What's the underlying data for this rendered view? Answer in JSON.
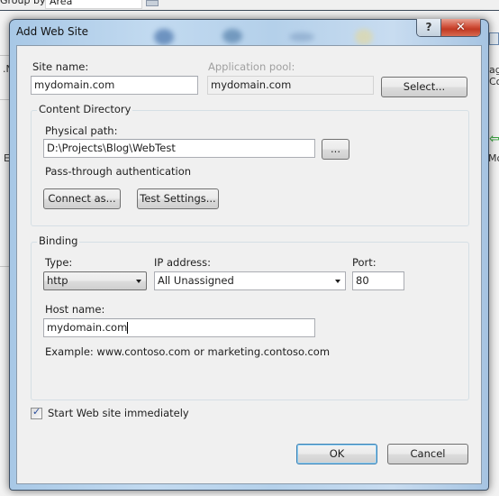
{
  "background": {
    "group_by_label": "Group by:",
    "group_by_value": "Area",
    "left_snippets": [
      ".N",
      "E"
    ],
    "right_snippets": [
      "age",
      "Cor",
      "Mo"
    ]
  },
  "dialog": {
    "title": "Add Web Site",
    "help_glyph": "?",
    "close_glyph": "✕",
    "site_name": {
      "label": "Site name:",
      "value": "mydomain.com"
    },
    "application_pool": {
      "label": "Application pool:",
      "value": "mydomain.com",
      "select_button": "Select..."
    },
    "content_directory": {
      "legend": "Content Directory",
      "physical_path_label": "Physical path:",
      "physical_path_value": "D:\\Projects\\Blog\\WebTest",
      "browse_button": "...",
      "auth_label": "Pass-through authentication",
      "connect_as_button": "Connect as...",
      "test_settings_button": "Test Settings..."
    },
    "binding": {
      "legend": "Binding",
      "type_label": "Type:",
      "type_value": "http",
      "ip_label": "IP address:",
      "ip_value": "All Unassigned",
      "port_label": "Port:",
      "port_value": "80",
      "host_label": "Host name:",
      "host_value": "mydomain.com",
      "example_text": "Example: www.contoso.com or marketing.contoso.com"
    },
    "start_immediately": {
      "label": "Start Web site immediately",
      "checked": true
    },
    "ok_button": "OK",
    "cancel_button": "Cancel"
  }
}
